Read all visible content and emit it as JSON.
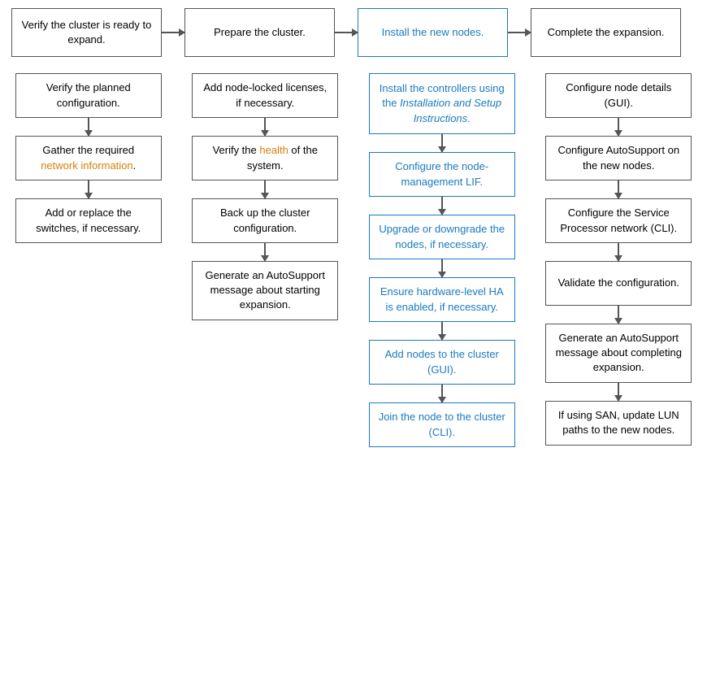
{
  "top": {
    "boxes": [
      {
        "id": "t1",
        "text": "Verify the cluster is ready to expand.",
        "highlight": false
      },
      {
        "id": "t2",
        "text": "Prepare the cluster.",
        "highlight": false
      },
      {
        "id": "t3",
        "text": "Install the new nodes.",
        "highlight": true
      },
      {
        "id": "t4",
        "text": "Complete the expansion.",
        "highlight": false
      }
    ]
  },
  "columns": [
    {
      "id": "col1",
      "items": [
        {
          "id": "c1r1",
          "text": "Verify the planned configuration.",
          "highlight": false,
          "linkColor": null
        },
        {
          "id": "c1r2",
          "text": "Gather the required network information.",
          "highlight": false,
          "linkColor": "orange"
        },
        {
          "id": "c1r3",
          "text": "Add or replace the switches, if necessary.",
          "highlight": false,
          "linkColor": null
        }
      ]
    },
    {
      "id": "col2",
      "items": [
        {
          "id": "c2r1",
          "text": "Add node-locked licenses, if necessary.",
          "highlight": false,
          "linkColor": null
        },
        {
          "id": "c2r2",
          "text": "Verify the health of the system.",
          "highlight": false,
          "linkColor": "orange"
        },
        {
          "id": "c2r3",
          "text": "Back up the cluster configuration.",
          "highlight": false,
          "linkColor": null
        },
        {
          "id": "c2r4",
          "text": "Generate an AutoSupport message about starting expansion.",
          "highlight": false,
          "linkColor": null
        }
      ]
    },
    {
      "id": "col3",
      "items": [
        {
          "id": "c3r1",
          "text": "Install the controllers using the Installation and Setup Instructions.",
          "highlight": true,
          "italic": "Installation and Setup Instructions"
        },
        {
          "id": "c3r2",
          "text": "Configure the node-management LIF.",
          "highlight": true
        },
        {
          "id": "c3r3",
          "text": "Upgrade or downgrade the nodes, if necessary.",
          "highlight": true
        },
        {
          "id": "c3r4",
          "text": "Ensure hardware-level HA is enabled, if necessary.",
          "highlight": true
        },
        {
          "id": "c3r5",
          "text": "Add nodes to the cluster (GUI).",
          "highlight": true
        },
        {
          "id": "c3r6",
          "text": "Join the node to the cluster (CLI).",
          "highlight": true
        }
      ]
    },
    {
      "id": "col4",
      "items": [
        {
          "id": "c4r1",
          "text": "Configure node details (GUI).",
          "highlight": false
        },
        {
          "id": "c4r2",
          "text": "Configure AutoSupport on the new nodes.",
          "highlight": false
        },
        {
          "id": "c4r3",
          "text": "Configure the Service Processor network (CLI).",
          "highlight": false
        },
        {
          "id": "c4r4",
          "text": "Validate the configuration.",
          "highlight": false
        },
        {
          "id": "c4r5",
          "text": "Generate an AutoSupport message about completing expansion.",
          "highlight": false
        },
        {
          "id": "c4r6",
          "text": "If using SAN, update LUN paths to the new nodes.",
          "highlight": false
        }
      ]
    }
  ]
}
